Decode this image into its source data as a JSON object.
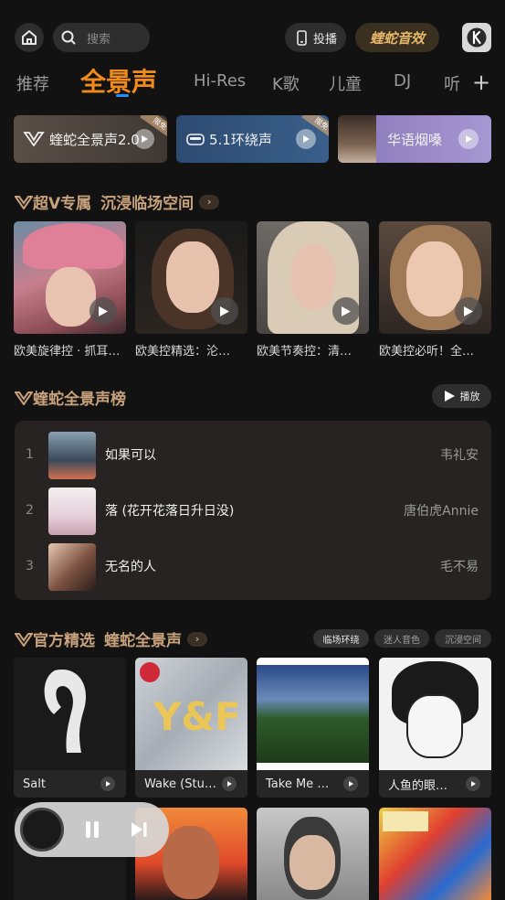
{
  "header": {
    "search_placeholder": "搜索",
    "cast_label": "投播",
    "effect_label": "蝰蛇音效"
  },
  "tabs": [
    "推荐",
    "全景声",
    "Hi-Res",
    "K歌",
    "儿童",
    "DJ",
    "听"
  ],
  "active_tab": "全景声",
  "features": [
    {
      "label": "蝰蛇全景声2.0",
      "badge": "限免"
    },
    {
      "label": "5.1环绕声",
      "badge": "限免"
    },
    {
      "label": "华语烟嗓"
    }
  ],
  "section1": {
    "title": "超V专属",
    "subtitle": "沉浸临场空间",
    "items": [
      {
        "caption": "欧美旋律控 · 抓耳…"
      },
      {
        "caption": "欧美控精选：沦…"
      },
      {
        "caption": "欧美节奏控：清…"
      },
      {
        "caption": "欧美控必听！全…"
      }
    ]
  },
  "section2": {
    "title": "蝰蛇全景声榜",
    "play_label": "播放",
    "rows": [
      {
        "rank": "1",
        "title": "如果可以",
        "artist": "韦礼安"
      },
      {
        "rank": "2",
        "title": "落 (花开花落日升日没)",
        "artist": "唐伯虎Annie"
      },
      {
        "rank": "3",
        "title": "无名的人",
        "artist": "毛不易"
      }
    ]
  },
  "section3": {
    "title": "官方精选",
    "subtitle": "蝰蛇全景声",
    "tags": [
      "临场环绕",
      "迷人音色",
      "沉浸空间"
    ],
    "albums": [
      {
        "label": "Salt"
      },
      {
        "label": "Wake (Stu…"
      },
      {
        "label": "Take Me …"
      },
      {
        "label": "人鱼的眼…"
      }
    ]
  },
  "colors": {
    "accent": "#f08a1a",
    "gold": "#c8a27c",
    "background": "#121212"
  }
}
